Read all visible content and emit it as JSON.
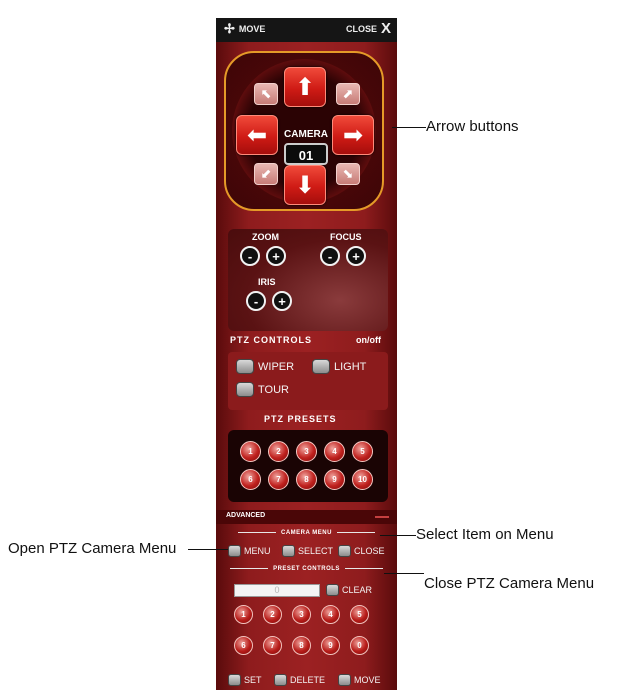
{
  "titlebar": {
    "move_label": "MOVE",
    "close_label": "CLOSE",
    "close_icon": "X"
  },
  "camera": {
    "label": "CAMERA",
    "number": "01"
  },
  "lens": {
    "zoom_label": "ZOOM",
    "focus_label": "FOCUS",
    "iris_label": "IRIS",
    "minus": "-",
    "plus": "+"
  },
  "ptz_controls_label": "PTZ CONTROLS",
  "ptz_onoff_label": "on/off",
  "aux": {
    "wiper": "WIPER",
    "light": "LIGHT",
    "tour": "TOUR"
  },
  "ptz_presets_label": "PTZ PRESETS",
  "presets": [
    "1",
    "2",
    "3",
    "4",
    "5",
    "6",
    "7",
    "8",
    "9",
    "10"
  ],
  "advanced_label": "ADVANCED",
  "camera_menu": {
    "header": "CAMERA MENU",
    "menu": "MENU",
    "select": "SELECT",
    "close": "CLOSE"
  },
  "preset_controls": {
    "header": "PRESET CONTROLS",
    "input_value": "0",
    "clear": "CLEAR",
    "keys": [
      "1",
      "2",
      "3",
      "4",
      "5",
      "6",
      "7",
      "8",
      "9",
      "0"
    ],
    "set": "SET",
    "delete": "DELETE",
    "move": "MOVE"
  },
  "annotations": {
    "arrow_buttons": "Arrow buttons",
    "select_item": "Select Item on Menu",
    "open_menu": "Open PTZ Camera Menu",
    "close_menu": "Close PTZ Camera Menu"
  },
  "colors": {
    "panel": "#9c2122",
    "accent_orange": "#e59a28",
    "button_red": "#cf1b15"
  }
}
